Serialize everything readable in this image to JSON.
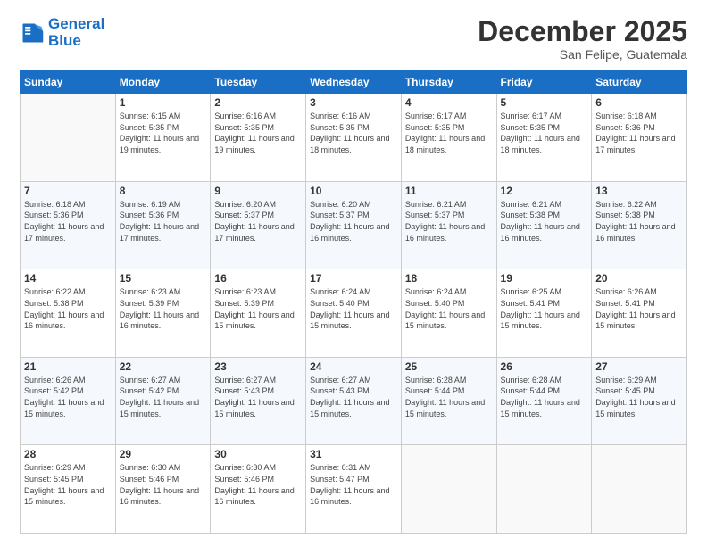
{
  "logo": {
    "line1": "General",
    "line2": "Blue"
  },
  "header": {
    "month": "December 2025",
    "location": "San Felipe, Guatemala"
  },
  "weekdays": [
    "Sunday",
    "Monday",
    "Tuesday",
    "Wednesday",
    "Thursday",
    "Friday",
    "Saturday"
  ],
  "weeks": [
    [
      {
        "day": "",
        "sunrise": "",
        "sunset": "",
        "daylight": ""
      },
      {
        "day": "1",
        "sunrise": "Sunrise: 6:15 AM",
        "sunset": "Sunset: 5:35 PM",
        "daylight": "Daylight: 11 hours and 19 minutes."
      },
      {
        "day": "2",
        "sunrise": "Sunrise: 6:16 AM",
        "sunset": "Sunset: 5:35 PM",
        "daylight": "Daylight: 11 hours and 19 minutes."
      },
      {
        "day": "3",
        "sunrise": "Sunrise: 6:16 AM",
        "sunset": "Sunset: 5:35 PM",
        "daylight": "Daylight: 11 hours and 18 minutes."
      },
      {
        "day": "4",
        "sunrise": "Sunrise: 6:17 AM",
        "sunset": "Sunset: 5:35 PM",
        "daylight": "Daylight: 11 hours and 18 minutes."
      },
      {
        "day": "5",
        "sunrise": "Sunrise: 6:17 AM",
        "sunset": "Sunset: 5:35 PM",
        "daylight": "Daylight: 11 hours and 18 minutes."
      },
      {
        "day": "6",
        "sunrise": "Sunrise: 6:18 AM",
        "sunset": "Sunset: 5:36 PM",
        "daylight": "Daylight: 11 hours and 17 minutes."
      }
    ],
    [
      {
        "day": "7",
        "sunrise": "Sunrise: 6:18 AM",
        "sunset": "Sunset: 5:36 PM",
        "daylight": "Daylight: 11 hours and 17 minutes."
      },
      {
        "day": "8",
        "sunrise": "Sunrise: 6:19 AM",
        "sunset": "Sunset: 5:36 PM",
        "daylight": "Daylight: 11 hours and 17 minutes."
      },
      {
        "day": "9",
        "sunrise": "Sunrise: 6:20 AM",
        "sunset": "Sunset: 5:37 PM",
        "daylight": "Daylight: 11 hours and 17 minutes."
      },
      {
        "day": "10",
        "sunrise": "Sunrise: 6:20 AM",
        "sunset": "Sunset: 5:37 PM",
        "daylight": "Daylight: 11 hours and 16 minutes."
      },
      {
        "day": "11",
        "sunrise": "Sunrise: 6:21 AM",
        "sunset": "Sunset: 5:37 PM",
        "daylight": "Daylight: 11 hours and 16 minutes."
      },
      {
        "day": "12",
        "sunrise": "Sunrise: 6:21 AM",
        "sunset": "Sunset: 5:38 PM",
        "daylight": "Daylight: 11 hours and 16 minutes."
      },
      {
        "day": "13",
        "sunrise": "Sunrise: 6:22 AM",
        "sunset": "Sunset: 5:38 PM",
        "daylight": "Daylight: 11 hours and 16 minutes."
      }
    ],
    [
      {
        "day": "14",
        "sunrise": "Sunrise: 6:22 AM",
        "sunset": "Sunset: 5:38 PM",
        "daylight": "Daylight: 11 hours and 16 minutes."
      },
      {
        "day": "15",
        "sunrise": "Sunrise: 6:23 AM",
        "sunset": "Sunset: 5:39 PM",
        "daylight": "Daylight: 11 hours and 16 minutes."
      },
      {
        "day": "16",
        "sunrise": "Sunrise: 6:23 AM",
        "sunset": "Sunset: 5:39 PM",
        "daylight": "Daylight: 11 hours and 15 minutes."
      },
      {
        "day": "17",
        "sunrise": "Sunrise: 6:24 AM",
        "sunset": "Sunset: 5:40 PM",
        "daylight": "Daylight: 11 hours and 15 minutes."
      },
      {
        "day": "18",
        "sunrise": "Sunrise: 6:24 AM",
        "sunset": "Sunset: 5:40 PM",
        "daylight": "Daylight: 11 hours and 15 minutes."
      },
      {
        "day": "19",
        "sunrise": "Sunrise: 6:25 AM",
        "sunset": "Sunset: 5:41 PM",
        "daylight": "Daylight: 11 hours and 15 minutes."
      },
      {
        "day": "20",
        "sunrise": "Sunrise: 6:26 AM",
        "sunset": "Sunset: 5:41 PM",
        "daylight": "Daylight: 11 hours and 15 minutes."
      }
    ],
    [
      {
        "day": "21",
        "sunrise": "Sunrise: 6:26 AM",
        "sunset": "Sunset: 5:42 PM",
        "daylight": "Daylight: 11 hours and 15 minutes."
      },
      {
        "day": "22",
        "sunrise": "Sunrise: 6:27 AM",
        "sunset": "Sunset: 5:42 PM",
        "daylight": "Daylight: 11 hours and 15 minutes."
      },
      {
        "day": "23",
        "sunrise": "Sunrise: 6:27 AM",
        "sunset": "Sunset: 5:43 PM",
        "daylight": "Daylight: 11 hours and 15 minutes."
      },
      {
        "day": "24",
        "sunrise": "Sunrise: 6:27 AM",
        "sunset": "Sunset: 5:43 PM",
        "daylight": "Daylight: 11 hours and 15 minutes."
      },
      {
        "day": "25",
        "sunrise": "Sunrise: 6:28 AM",
        "sunset": "Sunset: 5:44 PM",
        "daylight": "Daylight: 11 hours and 15 minutes."
      },
      {
        "day": "26",
        "sunrise": "Sunrise: 6:28 AM",
        "sunset": "Sunset: 5:44 PM",
        "daylight": "Daylight: 11 hours and 15 minutes."
      },
      {
        "day": "27",
        "sunrise": "Sunrise: 6:29 AM",
        "sunset": "Sunset: 5:45 PM",
        "daylight": "Daylight: 11 hours and 15 minutes."
      }
    ],
    [
      {
        "day": "28",
        "sunrise": "Sunrise: 6:29 AM",
        "sunset": "Sunset: 5:45 PM",
        "daylight": "Daylight: 11 hours and 15 minutes."
      },
      {
        "day": "29",
        "sunrise": "Sunrise: 6:30 AM",
        "sunset": "Sunset: 5:46 PM",
        "daylight": "Daylight: 11 hours and 16 minutes."
      },
      {
        "day": "30",
        "sunrise": "Sunrise: 6:30 AM",
        "sunset": "Sunset: 5:46 PM",
        "daylight": "Daylight: 11 hours and 16 minutes."
      },
      {
        "day": "31",
        "sunrise": "Sunrise: 6:31 AM",
        "sunset": "Sunset: 5:47 PM",
        "daylight": "Daylight: 11 hours and 16 minutes."
      },
      {
        "day": "",
        "sunrise": "",
        "sunset": "",
        "daylight": ""
      },
      {
        "day": "",
        "sunrise": "",
        "sunset": "",
        "daylight": ""
      },
      {
        "day": "",
        "sunrise": "",
        "sunset": "",
        "daylight": ""
      }
    ]
  ]
}
